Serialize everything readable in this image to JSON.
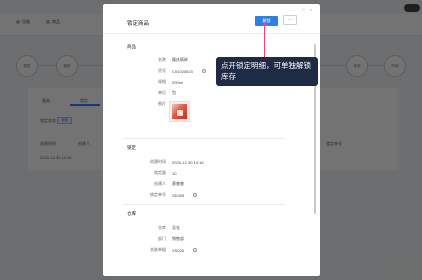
{
  "background": {
    "nav": [
      "设备",
      "商品",
      "",
      ""
    ],
    "circles": [
      "类型",
      "组织",
      "",
      "",
      "状态",
      "时间"
    ],
    "tabs": [
      "基础",
      "锁定"
    ],
    "chip": "全部",
    "filter_label": "锁定状态",
    "row_text": "2025-12-30 14:16",
    "col_labels": [
      "创建时间",
      "创建人",
      "锁定单号"
    ]
  },
  "drawer": {
    "title": "锁定商品",
    "unlock_label": "解锁",
    "more_label": "···",
    "window_controls": [
      "□",
      "×"
    ]
  },
  "product_section": {
    "title": "商品",
    "fields": [
      {
        "label": "名称",
        "value": "隆庆陨碎"
      },
      {
        "label": "货号",
        "value": "C01020023"
      },
      {
        "label": "规格",
        "value": "200ml"
      },
      {
        "label": "单位",
        "value": "包"
      },
      {
        "label": "图片",
        "value": ""
      }
    ]
  },
  "lock_section": {
    "title": "锁定",
    "fields": [
      {
        "label": "创建时间",
        "value": "2025-12-30 14:16"
      },
      {
        "label": "锁定量",
        "value": "10"
      },
      {
        "label": "创建人",
        "value": "蔡睿睿"
      },
      {
        "label": "锁定单号",
        "value": "SD309"
      }
    ]
  },
  "warehouse_section": {
    "title": "仓库",
    "fields": [
      {
        "label": "仓库",
        "value": "总仓"
      },
      {
        "label": "部门",
        "value": "销售部"
      },
      {
        "label": "关联单据",
        "value": "XS026"
      }
    ]
  },
  "callout": {
    "text": "点开锁定明细，可单独解锁库存"
  },
  "colors": {
    "primary": "#2f7fe0",
    "callout_bg": "#1f2a44",
    "pointer": "#e54b7a"
  }
}
